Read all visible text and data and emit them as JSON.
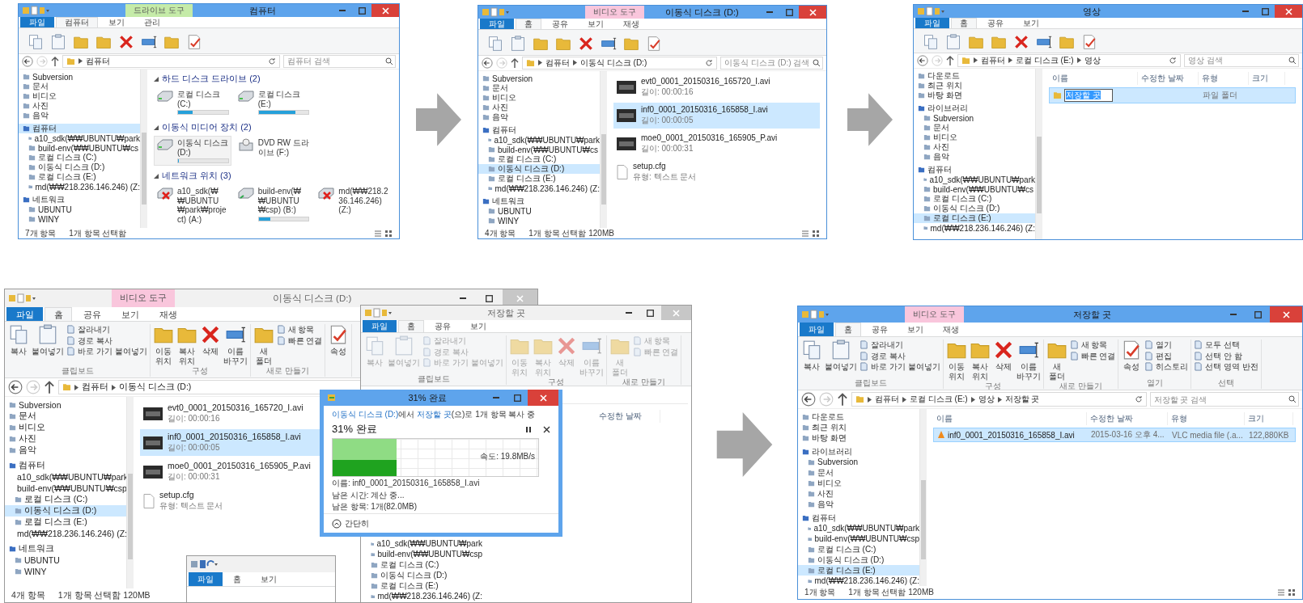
{
  "windows": [
    {
      "title": "컴퓨터",
      "active": true,
      "context_tab": {
        "label": "드라이브 도구",
        "color": "#c5eba8"
      },
      "tabs": [
        {
          "label": "파일",
          "kind": "file",
          "selected": false
        },
        {
          "label": "컴퓨터",
          "kind": "tab",
          "selected": true
        },
        {
          "label": "보기",
          "kind": "tab",
          "selected": false
        },
        {
          "label": "관리",
          "kind": "tab",
          "selected": false
        }
      ],
      "address": [
        "컴퓨터"
      ],
      "search": {
        "placeholder": "컴퓨터 검색"
      },
      "nav": [
        {
          "label": "Subversion",
          "selected": false
        },
        {
          "label": "문서",
          "selected": false
        },
        {
          "label": "비디오",
          "selected": false
        },
        {
          "label": "사진",
          "selected": false
        },
        {
          "label": "음악",
          "selected": false
        },
        {
          "label": "컴퓨터",
          "selected": true,
          "children": [
            {
              "label": "a10_sdk(₩₩UBUNTU₩park",
              "selected": false
            },
            {
              "label": "build-env(₩₩UBUNTU₩cs",
              "selected": false
            },
            {
              "label": "로컬 디스크 (C:)",
              "selected": false
            },
            {
              "label": "이동식 디스크 (D:)",
              "selected": false
            },
            {
              "label": "로컬 디스크 (E:)",
              "selected": false
            },
            {
              "label": "md(₩₩218.236.146.246) (Z:",
              "selected": false
            }
          ]
        },
        {
          "label": "네트워크",
          "selected": false,
          "children": [
            {
              "label": "UBUNTU",
              "selected": false
            },
            {
              "label": "WINY",
              "selected": false
            }
          ]
        }
      ],
      "content": {
        "kind": "drives",
        "groups": [
          {
            "label": "하드 디스크 드라이브 (2)",
            "items": [
              {
                "name": "로컬 디스크 (C:)",
                "kind": "disk",
                "level": 0.3,
                "selected": false
              },
              {
                "name": "로컬 디스크 (E:)",
                "kind": "disk",
                "level": 0.73,
                "selected": false
              }
            ]
          },
          {
            "label": "이동식 미디어 장치 (2)",
            "items": [
              {
                "name": "이동식 디스크 (D:)",
                "kind": "disk",
                "level": 0.02,
                "selected": true
              },
              {
                "name": "DVD RW 드라이브 (F:)",
                "kind": "optical",
                "selected": false
              }
            ]
          },
          {
            "label": "네트워크 위치 (3)",
            "items": [
              {
                "name": "a10_sdk(₩₩UBUNTU₩park₩project) (A:)",
                "kind": "offline",
                "selected": false
              },
              {
                "name": "build-env(₩₩UBUNTU₩csp) (B:)",
                "kind": "network",
                "level": 0.24,
                "selected": false
              },
              {
                "name": "md(₩₩218.236.146.246) (Z:)",
                "kind": "offline",
                "selected": false
              }
            ]
          }
        ]
      },
      "status": [
        "7개 항목",
        "1개 항목 선택함"
      ]
    },
    {
      "title": "이동식 디스크 (D:)",
      "active": true,
      "context_tab": {
        "label": "비디오 도구",
        "color": "#f9c6dc"
      },
      "tabs": [
        {
          "label": "파일",
          "kind": "file",
          "selected": false
        },
        {
          "label": "홈",
          "kind": "tab",
          "selected": true
        },
        {
          "label": "공유",
          "kind": "tab",
          "selected": false
        },
        {
          "label": "보기",
          "kind": "tab",
          "selected": false
        },
        {
          "label": "재생",
          "kind": "tab",
          "selected": false
        }
      ],
      "address": [
        "컴퓨터",
        "이동식 디스크 (D:)"
      ],
      "search": {
        "placeholder": "이동식 디스크 (D:) 검색"
      },
      "nav": [
        {
          "label": "Subversion",
          "selected": false
        },
        {
          "label": "문서",
          "selected": false
        },
        {
          "label": "비디오",
          "selected": false
        },
        {
          "label": "사진",
          "selected": false
        },
        {
          "label": "음악",
          "selected": false
        },
        {
          "label": "컴퓨터",
          "selected": false,
          "children": [
            {
              "label": "a10_sdk(₩₩UBUNTU₩park",
              "selected": false
            },
            {
              "label": "build-env(₩₩UBUNTU₩cs",
              "selected": false
            },
            {
              "label": "로컬 디스크 (C:)",
              "selected": false
            },
            {
              "label": "이동식 디스크 (D:)",
              "selected": true
            },
            {
              "label": "로컬 디스크 (E:)",
              "selected": false
            },
            {
              "label": "md(₩₩218.236.146.246) (Z:",
              "selected": false
            }
          ]
        },
        {
          "label": "네트워크",
          "selected": false,
          "children": [
            {
              "label": "UBUNTU",
              "selected": false
            },
            {
              "label": "WINY",
              "selected": false
            }
          ]
        }
      ],
      "content": {
        "kind": "tiles",
        "items": [
          {
            "name": "evt0_0001_20150316_165720_I.avi",
            "detail": "길이: 00:00:16",
            "kind": "video",
            "selected": false
          },
          {
            "name": "inf0_0001_20150316_165858_I.avi",
            "detail": "길이: 00:00:05",
            "kind": "video",
            "selected": true
          },
          {
            "name": "moe0_0001_20150316_165905_P.avi",
            "detail": "길이: 00:00:31",
            "kind": "video",
            "selected": false
          },
          {
            "name": "setup.cfg",
            "detail": "유형: 텍스트 문서",
            "kind": "text",
            "selected": false
          }
        ]
      },
      "status": [
        "4개 항목",
        "1개 항목 선택함 120MB"
      ]
    },
    {
      "title": "영상",
      "active": true,
      "tabs": [
        {
          "label": "파일",
          "kind": "file",
          "selected": false
        },
        {
          "label": "홈",
          "kind": "tab",
          "selected": true
        },
        {
          "label": "공유",
          "kind": "tab",
          "selected": false
        },
        {
          "label": "보기",
          "kind": "tab",
          "selected": false
        }
      ],
      "address": [
        "컴퓨터",
        "로컬 디스크 (E:)",
        "영상"
      ],
      "search": {
        "placeholder": "영상 검색"
      },
      "nav": [
        {
          "label": "다운로드",
          "selected": false
        },
        {
          "label": "최근 위치",
          "selected": false
        },
        {
          "label": "바탕 화면",
          "selected": false
        },
        {
          "label": "라이브러리",
          "selected": false,
          "children": [
            {
              "label": "Subversion",
              "selected": false
            },
            {
              "label": "문서",
              "selected": false
            },
            {
              "label": "비디오",
              "selected": false
            },
            {
              "label": "사진",
              "selected": false
            },
            {
              "label": "음악",
              "selected": false
            }
          ]
        },
        {
          "label": "컴퓨터",
          "selected": false,
          "children": [
            {
              "label": "a10_sdk(₩₩UBUNTU₩park",
              "selected": false
            },
            {
              "label": "build-env(₩₩UBUNTU₩cs",
              "selected": false
            },
            {
              "label": "로컬 디스크 (C:)",
              "selected": false
            },
            {
              "label": "이동식 디스크 (D:)",
              "selected": false
            },
            {
              "label": "로컬 디스크 (E:)",
              "selected": true
            },
            {
              "label": "md(₩₩218.236.146.246) (Z:",
              "selected": false
            }
          ]
        }
      ],
      "content": {
        "kind": "details",
        "columns": [
          "이름",
          "수정한 날짜",
          "유형",
          "크기"
        ],
        "rows": [
          {
            "name": "저장할 곳",
            "kind": "folder",
            "editing": true,
            "selected": true,
            "type": "파일 폴더"
          }
        ]
      }
    }
  ],
  "copy_scene": {
    "main": {
      "title": "이동식 디스크 (D:)",
      "active": false,
      "context_tab": {
        "label": "비디오 도구",
        "color": "#f9c6dc"
      },
      "tabs": [
        {
          "label": "파일",
          "kind": "file",
          "selected": false
        },
        {
          "label": "홈",
          "kind": "tab",
          "selected": true
        },
        {
          "label": "공유",
          "kind": "tab",
          "selected": false
        },
        {
          "label": "보기",
          "kind": "tab",
          "selected": false
        },
        {
          "label": "재생",
          "kind": "tab",
          "selected": false
        }
      ],
      "ribbon_disabled": false,
      "ribbon": [
        {
          "label": "클립보드",
          "items": [
            {
              "label": "복사",
              "kind": "page"
            },
            {
              "label": "붙여넣기",
              "kind": "clipboard"
            },
            {
              "label": "잘라내기",
              "kind": "small"
            },
            {
              "label": "경로 복사",
              "kind": "small"
            },
            {
              "label": "바로 가기 붙여넣기",
              "kind": "small"
            }
          ]
        },
        {
          "label": "구성",
          "items": [
            {
              "label": "이동 위치",
              "kind": "folder"
            },
            {
              "label": "복사 위치",
              "kind": "folder"
            },
            {
              "label": "삭제",
              "kind": "delete"
            },
            {
              "label": "이름 바꾸기",
              "kind": "rename"
            }
          ]
        },
        {
          "label": "새로 만들기",
          "items": [
            {
              "label": "새 폴더",
              "kind": "folder"
            },
            {
              "label": "새 항목",
              "kind": "small"
            },
            {
              "label": "빠른 연결",
              "kind": "small"
            }
          ]
        },
        {
          "items": [
            {
              "label": "속성",
              "kind": "check"
            }
          ]
        }
      ],
      "address": [
        "컴퓨터",
        "이동식 디스크 (D:)"
      ],
      "nav": [
        {
          "label": "Subversion",
          "selected": false
        },
        {
          "label": "문서",
          "selected": false
        },
        {
          "label": "비디오",
          "selected": false
        },
        {
          "label": "사진",
          "selected": false
        },
        {
          "label": "음악",
          "selected": false
        },
        {
          "label": "컴퓨터",
          "selected": false,
          "children": [
            {
              "label": "a10_sdk(₩₩UBUNTU₩park",
              "selected": false
            },
            {
              "label": "build-env(₩₩UBUNTU₩csp",
              "selected": false
            },
            {
              "label": "로컬 디스크 (C:)",
              "selected": false
            },
            {
              "label": "이동식 디스크 (D:)",
              "selected": true
            },
            {
              "label": "로컬 디스크 (E:)",
              "selected": false
            },
            {
              "label": "md(₩₩218.236.146.246) (Z:",
              "selected": false
            }
          ]
        },
        {
          "label": "네트워크",
          "selected": false,
          "children": [
            {
              "label": "UBUNTU",
              "selected": false
            },
            {
              "label": "WINY",
              "selected": false
            }
          ]
        }
      ],
      "content": {
        "kind": "tiles",
        "items": [
          {
            "name": "evt0_0001_20150316_165720_I.avi",
            "detail": "길이: 00:00:16",
            "kind": "video",
            "selected": false
          },
          {
            "name": "inf0_0001_20150316_165858_I.avi",
            "detail": "길이: 00:00:05",
            "kind": "video",
            "selected": true
          },
          {
            "name": "moe0_0001_20150316_165905_P.avi",
            "detail": "길이: 00:00:31",
            "kind": "video",
            "selected": false
          },
          {
            "name": "setup.cfg",
            "detail": "유형: 텍스트 문서",
            "kind": "text",
            "selected": false
          }
        ]
      },
      "status": [
        "4개 항목",
        "1개 항목 선택함 120MB"
      ]
    },
    "back": {
      "title": "저장할 곳",
      "active": false,
      "tabs": [
        {
          "label": "파일",
          "kind": "file",
          "selected": false
        },
        {
          "label": "홈",
          "kind": "tab",
          "selected": true
        },
        {
          "label": "공유",
          "kind": "tab",
          "selected": false
        },
        {
          "label": "보기",
          "kind": "tab",
          "selected": false
        }
      ],
      "ribbon_disabled": true,
      "ribbon": [
        {
          "label": "클립보드",
          "items": [
            {
              "label": "복사",
              "kind": "page"
            },
            {
              "label": "붙여넣기",
              "kind": "clipboard"
            },
            {
              "label": "잘라내기",
              "kind": "small"
            },
            {
              "label": "경로 복사",
              "kind": "small"
            },
            {
              "label": "바로 가기 붙여넣기",
              "kind": "small"
            }
          ]
        },
        {
          "label": "구성",
          "items": [
            {
              "label": "이동 위치",
              "kind": "folder"
            },
            {
              "label": "복사 위치",
              "kind": "folder"
            },
            {
              "label": "삭제",
              "kind": "delete"
            },
            {
              "label": "이름 바꾸기",
              "kind": "rename"
            }
          ]
        },
        {
          "label": "새로 만들기",
          "items": [
            {
              "label": "새 폴더",
              "kind": "folder"
            },
            {
              "label": "새 항목",
              "kind": "small"
            },
            {
              "label": "빠른 연결",
              "kind": "small"
            }
          ]
        }
      ],
      "column": "수정한 날짜",
      "nav": [
        {
          "label": "a10_sdk(₩₩UBUNTU₩park",
          "selected": false
        },
        {
          "label": "build-env(₩₩UBUNTU₩csp",
          "selected": false
        },
        {
          "label": "로컬 디스크 (C:)",
          "selected": false
        },
        {
          "label": "이동식 디스크 (D:)",
          "selected": false
        },
        {
          "label": "로컬 디스크 (E:)",
          "selected": false
        },
        {
          "label": "md(₩₩218.236.146.246) (Z:",
          "selected": false
        }
      ]
    },
    "mini": {
      "tabs": [
        {
          "label": "파일",
          "kind": "file",
          "selected": false
        },
        {
          "label": "홈",
          "kind": "tab",
          "selected": false
        },
        {
          "label": "보기",
          "kind": "tab",
          "selected": false
        }
      ]
    },
    "dialog": {
      "title": "31% 완료",
      "message": [
        {
          "text": "이동식 디스크 (D:)",
          "kind": "link"
        },
        {
          "text": "에서 ",
          "kind": "plain"
        },
        {
          "text": "저장할 곳",
          "kind": "link"
        },
        {
          "text": "(으)로 1개 항목 복사 중",
          "kind": "plain"
        }
      ],
      "heading": "31% 완료",
      "level": 0.31,
      "speed": "속도: 19.8MB/s",
      "details": [
        "이름: inf0_0001_20150316_165858_I.avi",
        "남은 시간: 계산 중...",
        "남은 항목: 1개(82.0MB)"
      ],
      "toggle": "간단히"
    }
  },
  "result_window": {
    "title": "저장할 곳",
    "active": true,
    "context_tab": {
      "label": "비디오 도구",
      "color": "#f9c6dc"
    },
    "tabs": [
      {
        "label": "파일",
        "kind": "file",
        "selected": false
      },
      {
        "label": "홈",
        "kind": "tab",
        "selected": true
      },
      {
        "label": "공유",
        "kind": "tab",
        "selected": false
      },
      {
        "label": "보기",
        "kind": "tab",
        "selected": false
      },
      {
        "label": "재생",
        "kind": "tab",
        "selected": false
      }
    ],
    "ribbon_disabled": false,
    "ribbon": [
      {
        "label": "클립보드",
        "items": [
          {
            "label": "복사",
            "kind": "page"
          },
          {
            "label": "붙여넣기",
            "kind": "clipboard"
          },
          {
            "label": "잘라내기",
            "kind": "small"
          },
          {
            "label": "경로 복사",
            "kind": "small"
          },
          {
            "label": "바로 가기 붙여넣기",
            "kind": "small"
          }
        ]
      },
      {
        "label": "구성",
        "items": [
          {
            "label": "이동 위치",
            "kind": "folder"
          },
          {
            "label": "복사 위치",
            "kind": "folder"
          },
          {
            "label": "삭제",
            "kind": "delete"
          },
          {
            "label": "이름 바꾸기",
            "kind": "rename"
          }
        ]
      },
      {
        "label": "새로 만들기",
        "items": [
          {
            "label": "새 폴더",
            "kind": "folder"
          },
          {
            "label": "새 항목",
            "kind": "small"
          },
          {
            "label": "빠른 연결",
            "kind": "small"
          }
        ]
      },
      {
        "label": "열기",
        "items": [
          {
            "label": "속성",
            "kind": "check"
          },
          {
            "label": "열기",
            "kind": "small"
          },
          {
            "label": "편집",
            "kind": "small"
          },
          {
            "label": "히스토리",
            "kind": "small"
          }
        ]
      },
      {
        "label": "선택",
        "items": [
          {
            "label": "모두 선택",
            "kind": "small"
          },
          {
            "label": "선택 안 함",
            "kind": "small"
          },
          {
            "label": "선택 영역 반전",
            "kind": "small"
          }
        ]
      }
    ],
    "address": [
      "컴퓨터",
      "로컬 디스크 (E:)",
      "영상",
      "저장할 곳"
    ],
    "search": {
      "placeholder": "저장할 곳 검색"
    },
    "nav": [
      {
        "label": "다운로드",
        "selected": false
      },
      {
        "label": "최근 위치",
        "selected": false
      },
      {
        "label": "바탕 화면",
        "selected": false
      },
      {
        "label": "라이브러리",
        "selected": false,
        "children": [
          {
            "label": "Subversion",
            "selected": false
          },
          {
            "label": "문서",
            "selected": false
          },
          {
            "label": "비디오",
            "selected": false
          },
          {
            "label": "사진",
            "selected": false
          },
          {
            "label": "음악",
            "selected": false
          }
        ]
      },
      {
        "label": "컴퓨터",
        "selected": false,
        "children": [
          {
            "label": "a10_sdk(₩₩UBUNTU₩park",
            "selected": false
          },
          {
            "label": "build-env(₩₩UBUNTU₩csp",
            "selected": false
          },
          {
            "label": "로컬 디스크 (C:)",
            "selected": false
          },
          {
            "label": "이동식 디스크 (D:)",
            "selected": false
          },
          {
            "label": "로컬 디스크 (E:)",
            "selected": true
          },
          {
            "label": "md(₩₩218.236.146.246) (Z:",
            "selected": false
          }
        ]
      }
    ],
    "content": {
      "kind": "details",
      "columns": [
        "이름",
        "수정한 날짜",
        "유형",
        "크기"
      ],
      "rows": [
        {
          "name": "inf0_0001_20150316_165858_I.avi",
          "kind": "video",
          "editing": false,
          "selected": true,
          "date": "2015-03-16 오후 4...",
          "type": "VLC media file (.a...",
          "size": "122,880KB"
        }
      ]
    },
    "status": [
      "1개 항목",
      "1개 항목 선택함 120MB"
    ]
  }
}
